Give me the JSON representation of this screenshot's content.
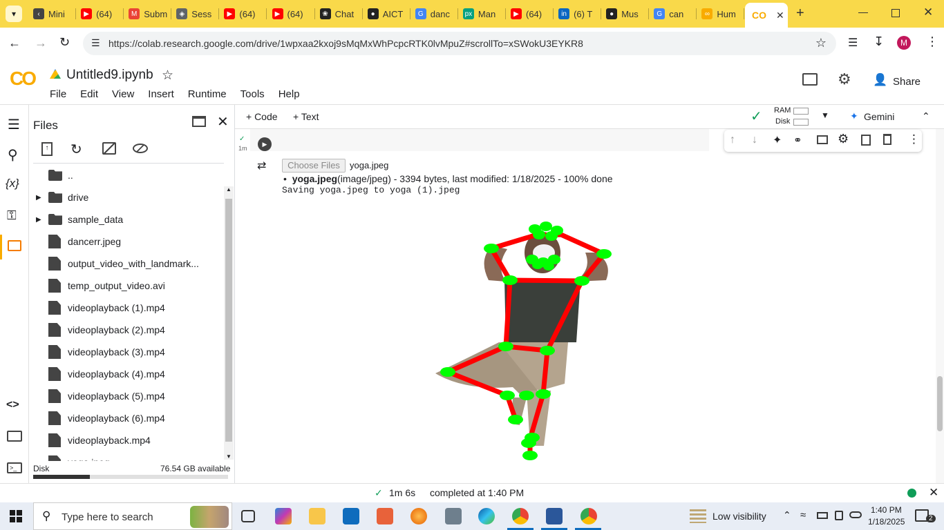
{
  "browser": {
    "tabs": [
      {
        "label": "Mini",
        "icon": "back-arrow-icon"
      },
      {
        "label": "(64)",
        "icon": "youtube-icon"
      },
      {
        "label": "Subm",
        "icon": "gmail-icon"
      },
      {
        "label": "Sess",
        "icon": "session-icon"
      },
      {
        "label": "(64)",
        "icon": "youtube-icon"
      },
      {
        "label": "(64)",
        "icon": "youtube-icon"
      },
      {
        "label": "Chat",
        "icon": "chatgpt-icon"
      },
      {
        "label": "AICT",
        "icon": "github-icon"
      },
      {
        "label": "danc",
        "icon": "google-icon"
      },
      {
        "label": "Man",
        "icon": "pexels-icon"
      },
      {
        "label": "(64)",
        "icon": "youtube-icon"
      },
      {
        "label": "(6) T",
        "icon": "linkedin-icon"
      },
      {
        "label": "Mus",
        "icon": "github-icon"
      },
      {
        "label": "can",
        "icon": "google-icon"
      },
      {
        "label": "Hum",
        "icon": "colab-icon"
      }
    ],
    "url": "https://colab.research.google.com/drive/1wpxaa2kxoj9sMqMxWhPcpcRTK0lvMpuZ#scrollTo=xSWokU3EYKR8",
    "profile_initial": "M"
  },
  "colab": {
    "logo": "CO",
    "notebook_title": "Untitled9.ipynb",
    "menu": [
      "File",
      "Edit",
      "View",
      "Insert",
      "Runtime",
      "Tools",
      "Help"
    ],
    "share_label": "Share",
    "add_code": "+ Code",
    "add_text": "+ Text",
    "ram_label": "RAM",
    "disk_label": "Disk",
    "gemini_label": "Gemini"
  },
  "files_panel": {
    "title": "Files",
    "items": [
      {
        "name": "..",
        "type": "folder-up"
      },
      {
        "name": "drive",
        "type": "folder"
      },
      {
        "name": "sample_data",
        "type": "folder"
      },
      {
        "name": "dancerr.jpeg",
        "type": "file"
      },
      {
        "name": "output_video_with_landmark...",
        "type": "file"
      },
      {
        "name": "temp_output_video.avi",
        "type": "file"
      },
      {
        "name": "videoplayback (1).mp4",
        "type": "file"
      },
      {
        "name": "videoplayback (2).mp4",
        "type": "file"
      },
      {
        "name": "videoplayback (3).mp4",
        "type": "file"
      },
      {
        "name": "videoplayback (4).mp4",
        "type": "file"
      },
      {
        "name": "videoplayback (5).mp4",
        "type": "file"
      },
      {
        "name": "videoplayback (6).mp4",
        "type": "file"
      },
      {
        "name": "videoplayback.mp4",
        "type": "file"
      },
      {
        "name": "yoga.jpeg",
        "type": "file"
      }
    ],
    "disk_label": "Disk",
    "disk_available": "76.54 GB available",
    "disk_used_fraction": 0.29
  },
  "cell": {
    "exec_time": "1m",
    "choose_files_label": "Choose Files",
    "chosen_file": "yoga.jpeg",
    "upload_name": "yoga.jpeg",
    "upload_detail": "(image/jpeg) - 3394 bytes, last modified: 1/18/2025 - 100% done",
    "saving_line": "Saving yoga.jpeg to yoga (1).jpeg"
  },
  "statusbar": {
    "duration": "1m 6s",
    "completed": "completed at 1:40 PM"
  },
  "taskbar": {
    "search_placeholder": "Type here to search",
    "weather": "Low visibility",
    "time": "1:40 PM",
    "date": "1/18/2025",
    "notifications": "2"
  },
  "colors": {
    "tabbar": "#f9d94a",
    "colab_orange": "#f9ab00",
    "skeleton_line": "#ff0000",
    "landmark": "#00ff00",
    "run_ok": "#0f9d58"
  }
}
